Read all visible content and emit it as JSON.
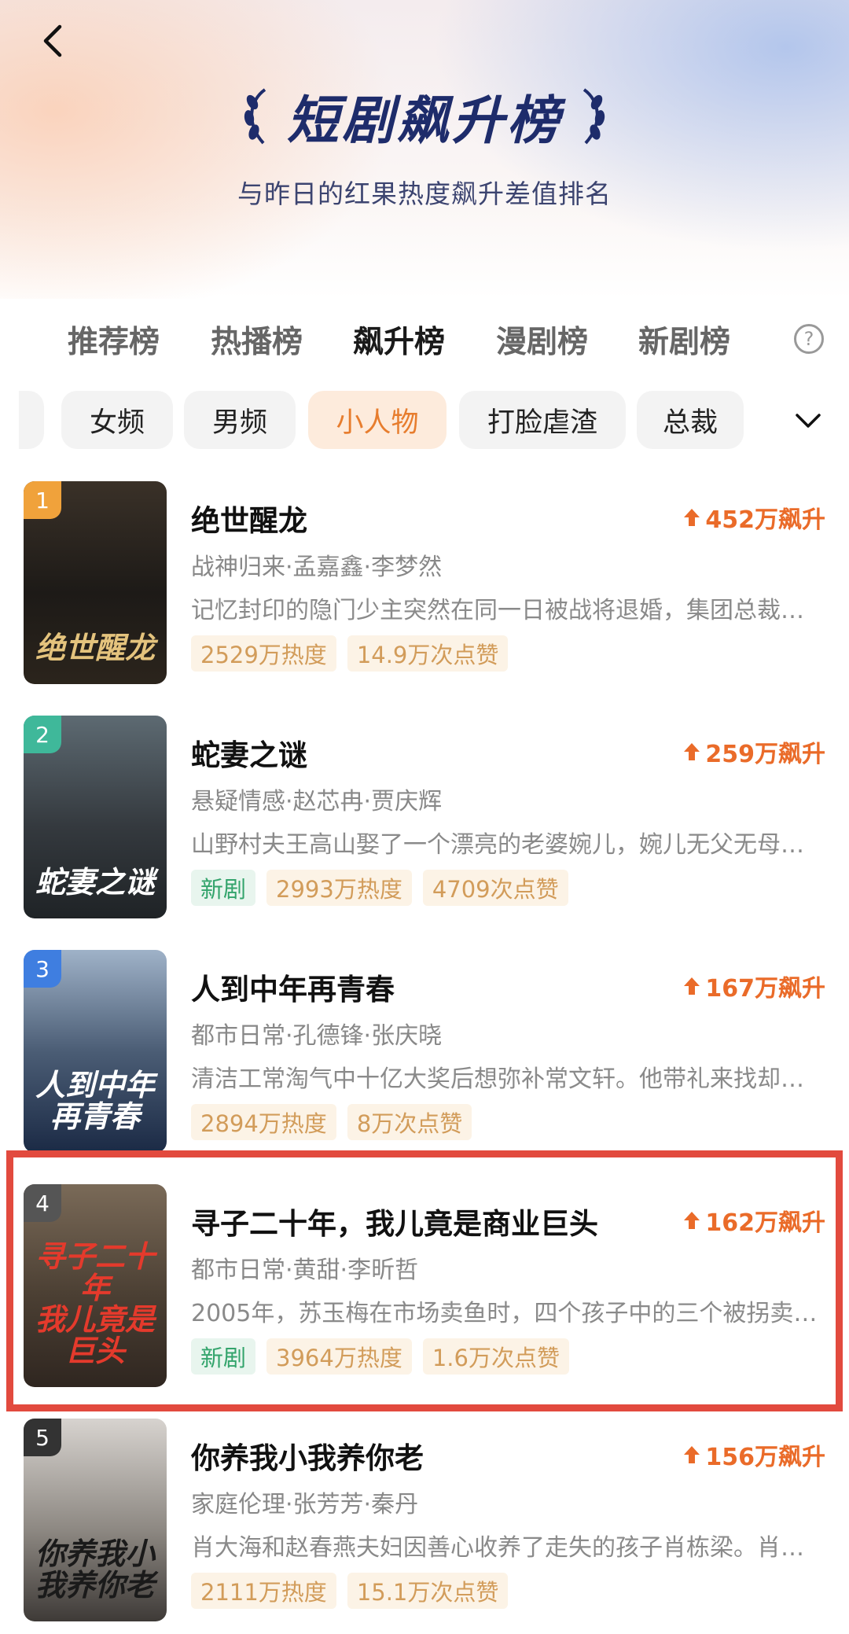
{
  "header": {
    "back_icon": "chevron-left-icon",
    "title": "短剧飙升榜",
    "subtitle": "与昨日的红果热度飙升差值排名"
  },
  "tabs": [
    {
      "label": "推荐榜",
      "active": false
    },
    {
      "label": "热播榜",
      "active": false
    },
    {
      "label": "飙升榜",
      "active": true
    },
    {
      "label": "漫剧榜",
      "active": false
    },
    {
      "label": "新剧榜",
      "active": false
    }
  ],
  "help_icon": "?",
  "chips": [
    {
      "label": "女频",
      "active": false
    },
    {
      "label": "男频",
      "active": false
    },
    {
      "label": "小人物",
      "active": true
    },
    {
      "label": "打脸虐渣",
      "active": false
    },
    {
      "label": "总裁",
      "active": false
    }
  ],
  "colors": {
    "accent": "#ea6b29",
    "title": "#1e2c6b",
    "highlight": "#e24a3e",
    "tag_new": "#33a46c",
    "tag_stat": "#d29c5a"
  },
  "items": [
    {
      "rank": "1",
      "rank_color": "#f0a23b",
      "title": "绝世醒龙",
      "rise": "452万飙升",
      "meta": "战神归来·孟嘉鑫·李梦然",
      "desc": "记忆封印的隐门少主突然在同一日被战将退婚，集团总裁…",
      "tags": [
        "2529万热度",
        "14.9万次点赞"
      ],
      "new": false,
      "poster_text": "绝世醒龙",
      "poster_bg": "linear-gradient(180deg,#3a3128 0%,#1d1a17 55%,#2b241c 100%)",
      "poster_fg": "#e4c37d"
    },
    {
      "rank": "2",
      "rank_color": "#3fb89a",
      "title": "蛇妻之谜",
      "rise": "259万飙升",
      "meta": "悬疑情感·赵芯冉·贾庆辉",
      "desc": "山野村夫王高山娶了一个漂亮的老婆婉儿，婉儿无父无母…",
      "tags": [
        "2993万热度",
        "4709次点赞"
      ],
      "new": true,
      "new_label": "新剧",
      "poster_text": "蛇妻之谜",
      "poster_bg": "linear-gradient(180deg,#5d6a72 0%,#34393e 55%,#1f2326 100%)",
      "poster_fg": "#ffffff"
    },
    {
      "rank": "3",
      "rank_color": "#3f7ee0",
      "title": "人到中年再青春",
      "rise": "167万飙升",
      "meta": "都市日常·孔德锋·张庆晓",
      "desc": "清洁工常淘气中十亿大奖后想弥补常文轩。他带礼来找却…",
      "tags": [
        "2894万热度",
        "8万次点赞"
      ],
      "new": false,
      "poster_text": "人到中年\n再青春",
      "poster_bg": "linear-gradient(180deg,#9fb2c8 0%,#4b5d75 50%,#1b2a45 100%)",
      "poster_fg": "#ffffff"
    },
    {
      "rank": "4",
      "rank_color": "#555555",
      "title": "寻子二十年，我儿竟是商业巨头",
      "rise": "162万飙升",
      "meta": "都市日常·黄甜·李昕哲",
      "desc": "2005年，苏玉梅在市场卖鱼时，四个孩子中的三个被拐卖…",
      "tags": [
        "3964万热度",
        "1.6万次点赞"
      ],
      "new": true,
      "new_label": "新剧",
      "poster_text": "寻子二十年\n我儿竟是巨头",
      "poster_bg": "linear-gradient(180deg,#7a6a58 0%,#4b3f33 55%,#2f2620 100%)",
      "poster_fg": "#e43a2c"
    },
    {
      "rank": "5",
      "rank_color": "#333333",
      "title": "你养我小我养你老",
      "rise": "156万飙升",
      "meta": "家庭伦理·张芳芳·秦丹",
      "desc": "肖大海和赵春燕夫妇因善心收养了走失的孩子肖栋梁。肖…",
      "tags": [
        "2111万热度",
        "15.1万次点赞"
      ],
      "new": false,
      "poster_text": "你养我小\n我养你老",
      "poster_bg": "linear-gradient(180deg,#d7d3cf 0%,#8d8882 55%,#3e3a37 100%)",
      "poster_fg": "#1a1a1a"
    }
  ]
}
